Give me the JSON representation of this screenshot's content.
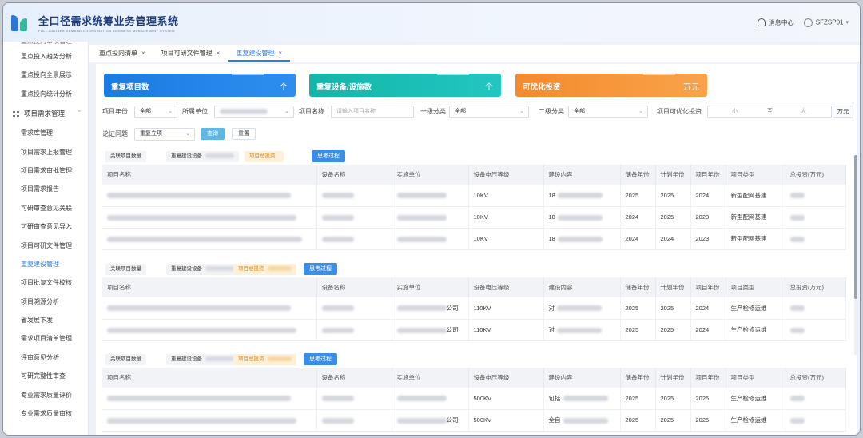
{
  "app": {
    "title": "全口径需求统筹业务管理系统",
    "subtitle": "FULL-CALIBER DEMAND COORDINATION BUSINESS MANAGEMENT SYSTEM"
  },
  "header": {
    "messages_label": "消息中心",
    "user_label": "SFZSP01"
  },
  "sidebar": {
    "items": [
      {
        "label": "重点投向审核管理",
        "partial": true
      },
      {
        "label": "重点投入趋势分析"
      },
      {
        "label": "重点投向全景展示"
      },
      {
        "label": "重点投向统计分析"
      },
      {
        "label": "项目需求管理",
        "group": true
      },
      {
        "label": "需求库管理"
      },
      {
        "label": "项目需求上报管理"
      },
      {
        "label": "项目需求审批管理"
      },
      {
        "label": "项目需求报告"
      },
      {
        "label": "可研审查意见关联"
      },
      {
        "label": "可研审查意见导入"
      },
      {
        "label": "项目可研文件管理"
      },
      {
        "label": "重复建设管理",
        "active": true
      },
      {
        "label": "项目批复文件校核"
      },
      {
        "label": "项目溯源分析"
      },
      {
        "label": "省发展下发"
      },
      {
        "label": "需求项目清单管理"
      },
      {
        "label": "评审意见分析"
      },
      {
        "label": "可研完整性审查"
      },
      {
        "label": "专业需求质量评价"
      },
      {
        "label": "专业需求质量审核"
      }
    ]
  },
  "tabs": [
    {
      "label": "重点投向清单",
      "active": false
    },
    {
      "label": "项目可研文件管理",
      "active": false
    },
    {
      "label": "重复建设管理",
      "active": true
    }
  ],
  "cards": [
    {
      "label": "重复项目数",
      "value": "个"
    },
    {
      "label": "重复设备/设施数",
      "value": "个"
    },
    {
      "label": "可优化投资",
      "value": "万元"
    }
  ],
  "filters": {
    "year_label": "项目年份",
    "year_value": "全部",
    "unit_label": "所属单位",
    "name_label": "项目名称",
    "name_placeholder": "请输入项目名称",
    "cat1_label": "一级分类",
    "cat1_value": "全部",
    "cat2_label": "二级分类",
    "cat2_value": "全部",
    "invest_label": "项目可优化投资",
    "min_placeholder": "小",
    "to_label": "至",
    "max_placeholder": "大",
    "unit": "万元",
    "issue_label": "论证问题",
    "issue_value": "重复立项",
    "query_btn": "查询",
    "reset_btn": "重置"
  },
  "group_head": {
    "related_count": "关联项目数量",
    "repeat_equipment": "重复建设设备",
    "invest_tag": "项目总投资",
    "process_btn": "思考过程"
  },
  "table_headers": [
    "项目名称",
    "设备名称",
    "实施单位",
    "设备电压等级",
    "建设内容",
    "储备年份",
    "计划年份",
    "项目年份",
    "项目类型",
    "总投资(万元)"
  ],
  "groups": [
    {
      "rows": [
        {
          "voltage": "10KV",
          "content": "18",
          "reserve": "2025",
          "plan": "2025",
          "year": "2024",
          "type": "新型配网基建"
        },
        {
          "voltage": "10KV",
          "content": "18",
          "reserve": "2024",
          "plan": "2025",
          "year": "2023",
          "type": "新型配网基建"
        },
        {
          "voltage": "10KV",
          "content": "18",
          "reserve": "2024",
          "plan": "2024",
          "year": "2023",
          "type": "新型配网基建"
        }
      ]
    },
    {
      "rows": [
        {
          "voltage": "110KV",
          "unit_suffix": "公司",
          "content": "对",
          "reserve": "2025",
          "plan": "2025",
          "year": "2024",
          "type": "生产检修运维"
        },
        {
          "voltage": "110KV",
          "unit_suffix": "公司",
          "content": "对",
          "reserve": "2025",
          "plan": "2025",
          "year": "2024",
          "type": "生产检修运维"
        }
      ]
    },
    {
      "rows": [
        {
          "voltage": "500KV",
          "content": "包括",
          "reserve": "2025",
          "plan": "2025",
          "year": "2025",
          "type": "生产检修运维"
        },
        {
          "voltage": "500KV",
          "unit_suffix": "公司",
          "content": "全自",
          "reserve": "2025",
          "plan": "2025",
          "year": "2025",
          "type": "生产检修运维"
        }
      ]
    }
  ]
}
